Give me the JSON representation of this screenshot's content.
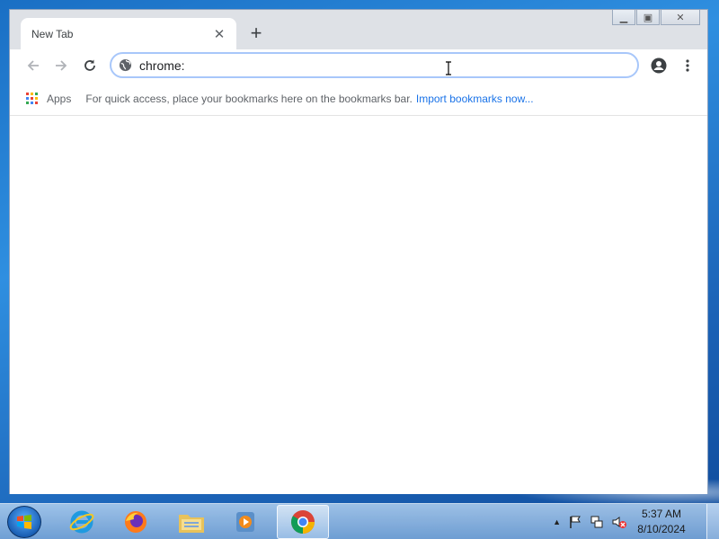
{
  "browser": {
    "tab": {
      "title": "New Tab",
      "close_glyph": "✕"
    },
    "new_tab_glyph": "+",
    "window_controls": {
      "minimize": "▁",
      "maximize": "▣",
      "close": "✕"
    },
    "toolbar": {
      "back_icon": "arrow-left-icon",
      "forward_icon": "arrow-right-icon",
      "reload_icon": "reload-icon",
      "address_value": "chrome:",
      "site_info_icon": "globe-icon",
      "profile_icon": "account-circle-icon",
      "menu_icon": "three-dots-vertical-icon"
    },
    "bookmarks_bar": {
      "apps_label": "Apps",
      "hint": "For quick access, place your bookmarks here on the bookmarks bar.",
      "import_link": "Import bookmarks now..."
    }
  },
  "taskbar": {
    "apps": [
      {
        "name": "internet-explorer",
        "active": false
      },
      {
        "name": "firefox",
        "active": false
      },
      {
        "name": "file-explorer",
        "active": false
      },
      {
        "name": "media-player",
        "active": false
      },
      {
        "name": "chrome",
        "active": true
      }
    ],
    "tray": {
      "show_hidden_glyph": "▲",
      "time": "5:37 AM",
      "date": "8/10/2024"
    }
  },
  "colors": {
    "accent": "#1a73e8",
    "omnibox_focus": "#a8c7fa",
    "desktop": "#2f8fe0",
    "apps_grid": [
      "#ea4335",
      "#fbbc04",
      "#34a853",
      "#4285f4",
      "#ea4335",
      "#fbbc04",
      "#34a853",
      "#4285f4",
      "#ea4335"
    ]
  }
}
